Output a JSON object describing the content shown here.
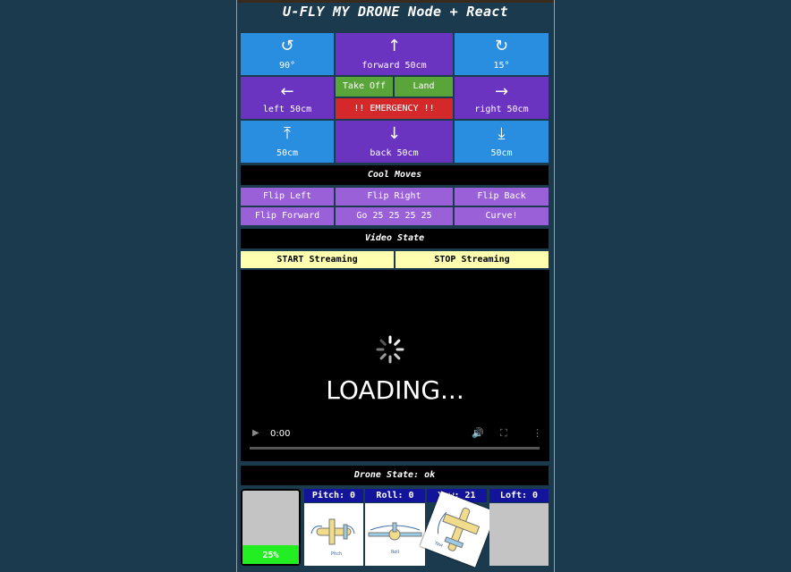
{
  "title": "U-FLY MY DRONE Node + React",
  "controls": {
    "rotate_ccw": {
      "icon": "↺",
      "label": "90°"
    },
    "forward": {
      "icon": "↑",
      "label": "forward 50cm"
    },
    "rotate_cw": {
      "icon": "↻",
      "label": "15°"
    },
    "left": {
      "icon": "←",
      "label": "left 50cm"
    },
    "takeoff": "Take Off",
    "land": "Land",
    "emergency": "!! EMERGENCY !!",
    "right": {
      "icon": "→",
      "label": "right 50cm"
    },
    "up": {
      "icon": "⤒",
      "label": "50cm"
    },
    "back": {
      "icon": "↓",
      "label": "back 50cm"
    },
    "down": {
      "icon": "⤓",
      "label": "50cm"
    }
  },
  "cool_moves": {
    "header": "Cool Moves",
    "flip_left": "Flip Left",
    "flip_right": "Flip Right",
    "flip_back": "Flip Back",
    "flip_forward": "Flip Forward",
    "go": "Go 25 25 25 25",
    "curve": "Curve!"
  },
  "video": {
    "header": "Video State",
    "start": "START Streaming",
    "stop": "STOP Streaming",
    "loading": "LOADING...",
    "time": "0:00"
  },
  "drone_state": {
    "header": "Drone State: ok",
    "battery": "25%",
    "battery_fraction": 0.25,
    "pitch": "Pitch: 0",
    "roll": "Roll: 0",
    "yaw": "Yaw: 21",
    "loft": "Loft: 0",
    "pitch_caption": "Pitch",
    "roll_caption": "Roll",
    "yaw_caption": "Yaw"
  },
  "colors": {
    "blue": "#2a8ee0",
    "purple": "#6a33c0",
    "green": "#5aa53a",
    "red": "#d4282a",
    "lavender": "#9a60d8",
    "battery": "#22ee22"
  }
}
